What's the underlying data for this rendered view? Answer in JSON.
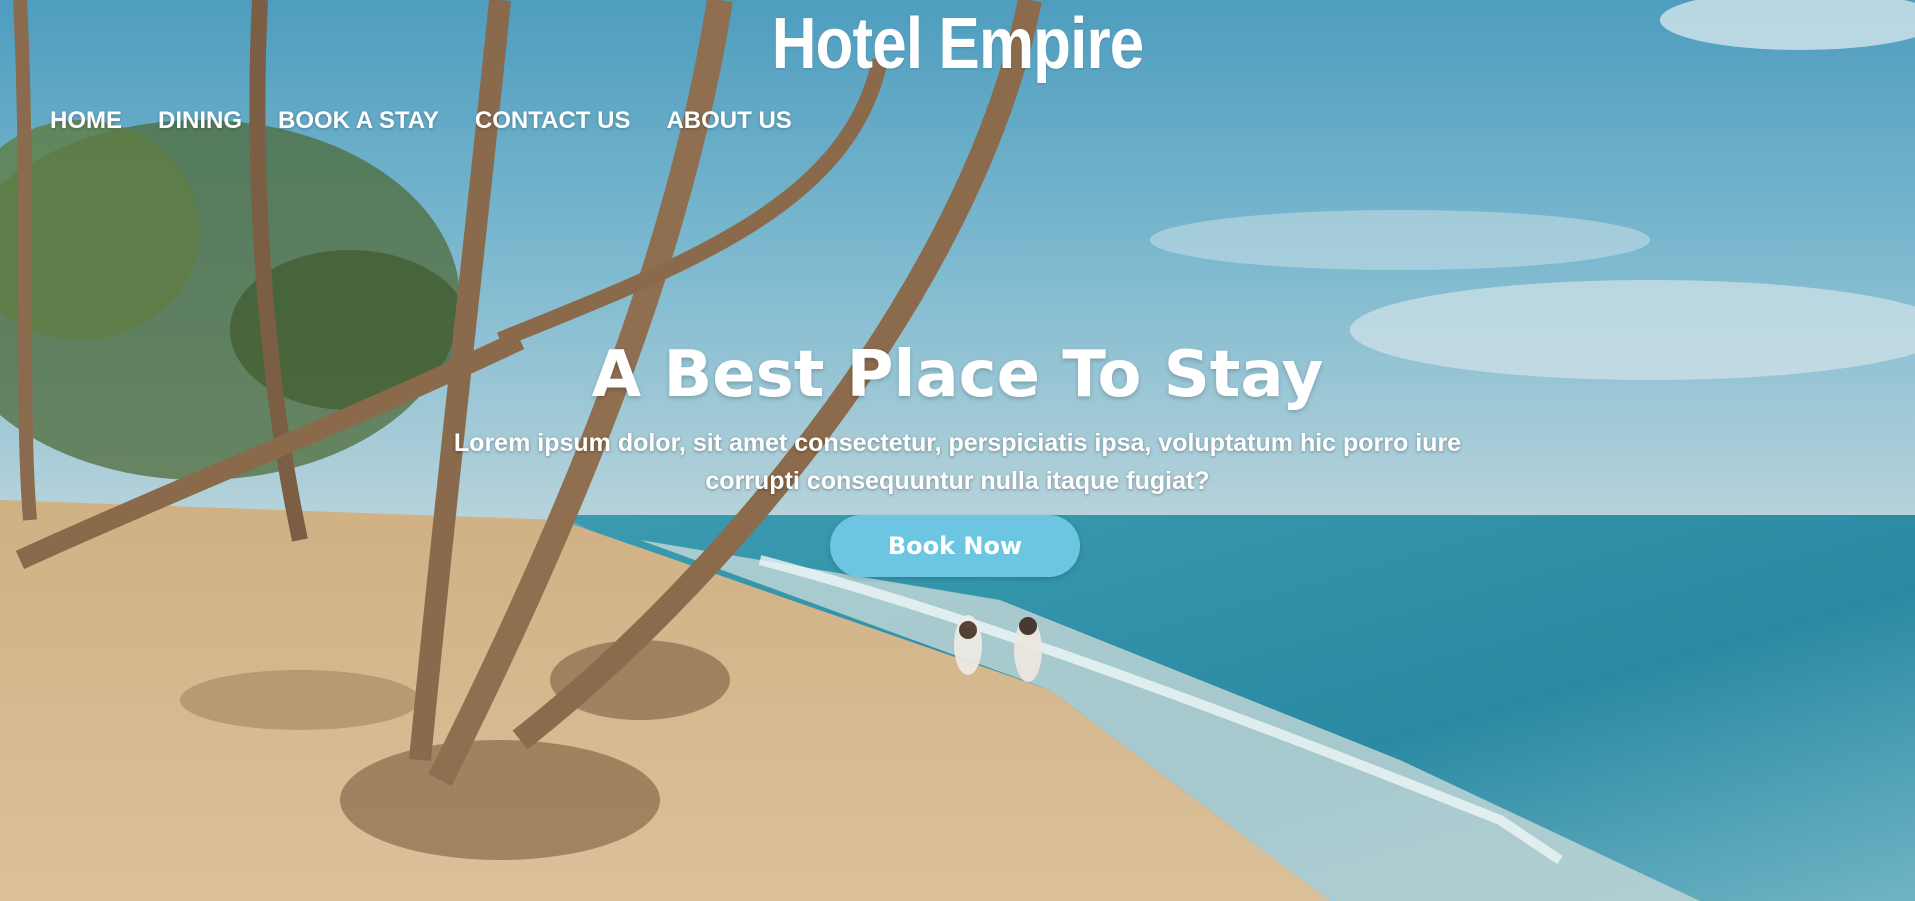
{
  "site": {
    "title": "Hotel Empire"
  },
  "nav": {
    "items": [
      {
        "label": "HOME"
      },
      {
        "label": "DINING"
      },
      {
        "label": "BOOK A STAY"
      },
      {
        "label": "CONTACT US"
      },
      {
        "label": "ABOUT US"
      }
    ]
  },
  "hero": {
    "headline": "A Best Place To Stay",
    "description": "Lorem ipsum dolor, sit amet consectetur, perspiciatis ipsa, voluptatum hic porro iure corrupti consequuntur nulla itaque fugiat?",
    "cta_label": "Book Now",
    "background": "beach-with-palm-trees-photo"
  },
  "colors": {
    "cta_background": "#6cc6e1",
    "text": "#ffffff",
    "sky": "#5aa7c4",
    "sea": "#2f8fa6",
    "sand": "#d9b98b"
  }
}
